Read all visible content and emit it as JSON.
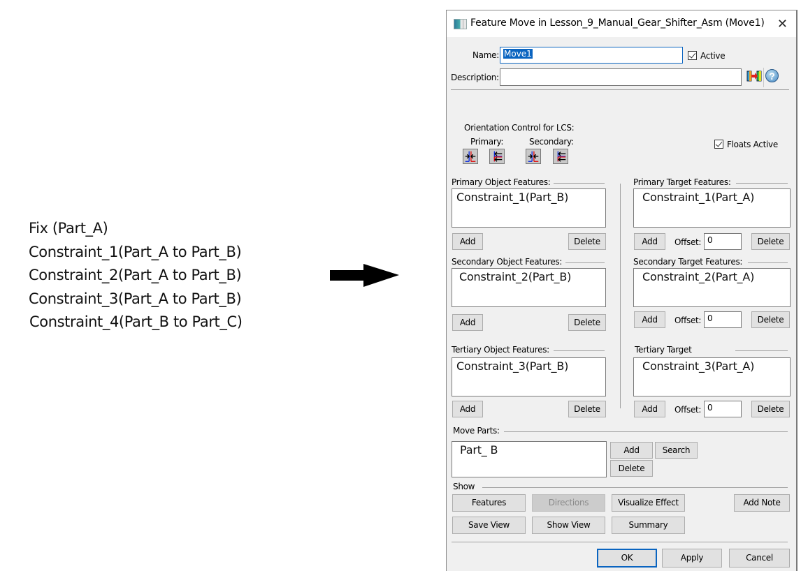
{
  "left_list": [
    "Fix (Part_A)",
    "Constraint_1(Part_A to Part_B)",
    "Constraint_2(Part_A to Part_B)",
    "Constraint_3(Part_A to Part_B)",
    "Constraint_4(Part_B to Part_C)"
  ],
  "arrow_icon": "right-arrow-icon",
  "dialog": {
    "title": "Feature Move in Lesson_9_Manual_Gear_Shifter_Asm (Move1)",
    "close_glyph": "✕",
    "name_label": "Name:",
    "name_value": "Move1",
    "active_label": "Active",
    "active_checked": true,
    "description_label": "Description:",
    "description_value": "",
    "help_glyph": "?",
    "orientation_label": "Orientation Control for LCS:",
    "primary_label": "Primary:",
    "secondary_label": "Secondary:",
    "floats_active_label": "Floats Active",
    "floats_active_checked": true,
    "primary_object": {
      "label": "Primary Object Features:",
      "items": [
        "Constraint_1(Part_B)"
      ],
      "add": "Add",
      "delete": "Delete"
    },
    "secondary_object": {
      "label": "Secondary Object Features:",
      "items": [
        "Constraint_2(Part_B)"
      ],
      "add": "Add",
      "delete": "Delete"
    },
    "tertiary_object": {
      "label": "Tertiary Object Features:",
      "items": [
        "Constraint_3(Part_B)"
      ],
      "add": "Add",
      "delete": "Delete"
    },
    "primary_target": {
      "label": "Primary Target Features:",
      "items": [
        "Constraint_1(Part_A)"
      ],
      "add": "Add",
      "offset_label": "Offset:",
      "offset_value": "0",
      "delete": "Delete"
    },
    "secondary_target": {
      "label": "Secondary Target Features:",
      "items": [
        "Constraint_2(Part_A)"
      ],
      "add": "Add",
      "offset_label": "Offset:",
      "offset_value": "0",
      "delete": "Delete"
    },
    "tertiary_target": {
      "label": "Tertiary Target",
      "items": [
        "Constraint_3(Part_A)"
      ],
      "add": "Add",
      "offset_label": "Offset:",
      "offset_value": "0",
      "delete": "Delete"
    },
    "move_parts": {
      "label": "Move Parts:",
      "items": [
        "Part_ B"
      ],
      "add": "Add",
      "search": "Search",
      "delete": "Delete"
    },
    "show": {
      "label": "Show",
      "features": "Features",
      "directions": "Directions",
      "visualize_effect": "Visualize Effect",
      "add_note": "Add Note",
      "save_view": "Save View",
      "show_view": "Show View",
      "summary": "Summary"
    },
    "ok": "OK",
    "apply": "Apply",
    "cancel": "Cancel"
  }
}
